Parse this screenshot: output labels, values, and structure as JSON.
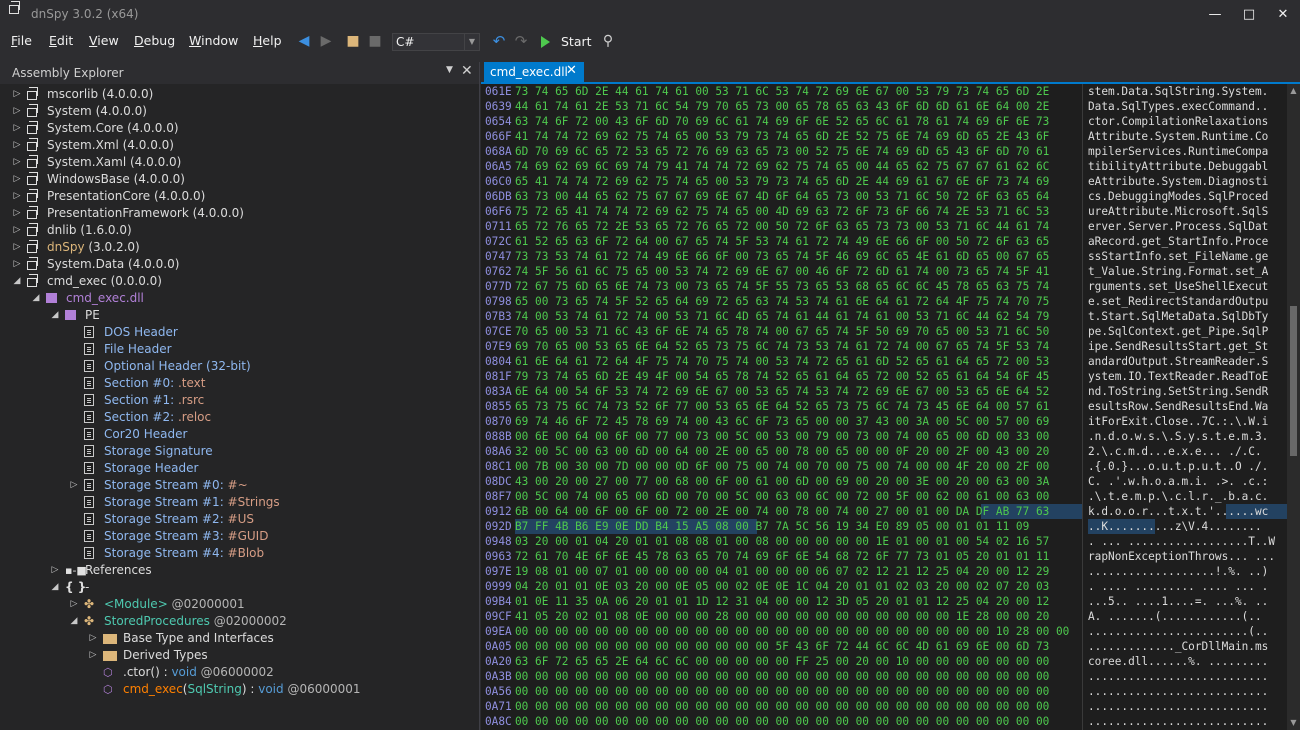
{
  "window": {
    "title": "dnSpy 3.0.2 (x64)",
    "minimize": "—",
    "maximize": "□",
    "close": "✕"
  },
  "menu": [
    "File",
    "Edit",
    "View",
    "Debug",
    "Window",
    "Help"
  ],
  "toolbar": {
    "language": "C#",
    "start_label": "Start"
  },
  "panel": {
    "title": "Assembly Explorer",
    "dropdown": "▼",
    "close": "✕"
  },
  "tree": [
    {
      "d": 0,
      "exp": "▷",
      "icon": "asm",
      "parts": [
        [
          "mscorlib",
          "w"
        ],
        [
          " (4.0.0.0)",
          "v"
        ]
      ]
    },
    {
      "d": 0,
      "exp": "▷",
      "icon": "asm",
      "parts": [
        [
          "System",
          "w"
        ],
        [
          " (4.0.0.0)",
          "v"
        ]
      ]
    },
    {
      "d": 0,
      "exp": "▷",
      "icon": "asm",
      "parts": [
        [
          "System.Core",
          "w"
        ],
        [
          " (4.0.0.0)",
          "v"
        ]
      ]
    },
    {
      "d": 0,
      "exp": "▷",
      "icon": "asm",
      "parts": [
        [
          "System.Xml",
          "w"
        ],
        [
          " (4.0.0.0)",
          "v"
        ]
      ]
    },
    {
      "d": 0,
      "exp": "▷",
      "icon": "asm",
      "parts": [
        [
          "System.Xaml",
          "w"
        ],
        [
          " (4.0.0.0)",
          "v"
        ]
      ]
    },
    {
      "d": 0,
      "exp": "▷",
      "icon": "asm",
      "parts": [
        [
          "WindowsBase",
          "w"
        ],
        [
          " (4.0.0.0)",
          "v"
        ]
      ]
    },
    {
      "d": 0,
      "exp": "▷",
      "icon": "asm",
      "parts": [
        [
          "PresentationCore",
          "w"
        ],
        [
          " (4.0.0.0)",
          "v"
        ]
      ]
    },
    {
      "d": 0,
      "exp": "▷",
      "icon": "asm",
      "parts": [
        [
          "PresentationFramework",
          "w"
        ],
        [
          " (4.0.0.0)",
          "v"
        ]
      ]
    },
    {
      "d": 0,
      "exp": "▷",
      "icon": "asm",
      "parts": [
        [
          "dnlib",
          "w"
        ],
        [
          " (1.6.0.0)",
          "v"
        ]
      ]
    },
    {
      "d": 0,
      "exp": "▷",
      "icon": "asm",
      "parts": [
        [
          "dnSpy",
          "y"
        ],
        [
          " (3.0.2.0)",
          "v"
        ]
      ]
    },
    {
      "d": 0,
      "exp": "▷",
      "icon": "asm",
      "parts": [
        [
          "System.Data",
          "w"
        ],
        [
          " (4.0.0.0)",
          "v"
        ]
      ]
    },
    {
      "d": 0,
      "exp": "◢",
      "icon": "asm",
      "parts": [
        [
          "cmd_exec",
          "w"
        ],
        [
          " (0.0.0.0)",
          "v"
        ]
      ]
    },
    {
      "d": 1,
      "exp": "◢",
      "icon": "mod",
      "parts": [
        [
          "cmd_exec.dll",
          "p"
        ]
      ]
    },
    {
      "d": 2,
      "exp": "◢",
      "icon": "mod",
      "parts": [
        [
          "PE",
          "w"
        ]
      ]
    },
    {
      "d": 3,
      "exp": "",
      "icon": "doc",
      "parts": [
        [
          "DOS Header",
          "lb"
        ]
      ]
    },
    {
      "d": 3,
      "exp": "",
      "icon": "doc",
      "parts": [
        [
          "File Header",
          "lb"
        ]
      ]
    },
    {
      "d": 3,
      "exp": "",
      "icon": "doc",
      "parts": [
        [
          "Optional Header (32-bit)",
          "lb"
        ]
      ]
    },
    {
      "d": 3,
      "exp": "",
      "icon": "doc",
      "parts": [
        [
          "Section #0: ",
          "lb"
        ],
        [
          ".text",
          "o"
        ]
      ]
    },
    {
      "d": 3,
      "exp": "",
      "icon": "doc",
      "parts": [
        [
          "Section #1: ",
          "lb"
        ],
        [
          ".rsrc",
          "o"
        ]
      ]
    },
    {
      "d": 3,
      "exp": "",
      "icon": "doc",
      "parts": [
        [
          "Section #2: ",
          "lb"
        ],
        [
          ".reloc",
          "o"
        ]
      ]
    },
    {
      "d": 3,
      "exp": "",
      "icon": "doc",
      "parts": [
        [
          "Cor20 Header",
          "lb"
        ]
      ]
    },
    {
      "d": 3,
      "exp": "",
      "icon": "doc",
      "parts": [
        [
          "Storage Signature",
          "lb"
        ]
      ]
    },
    {
      "d": 3,
      "exp": "",
      "icon": "doc",
      "parts": [
        [
          "Storage Header",
          "lb"
        ]
      ]
    },
    {
      "d": 3,
      "exp": "▷",
      "icon": "doc",
      "parts": [
        [
          "Storage Stream #0: ",
          "lb"
        ],
        [
          "#~",
          "o"
        ]
      ]
    },
    {
      "d": 3,
      "exp": "",
      "icon": "doc",
      "parts": [
        [
          "Storage Stream #1: ",
          "lb"
        ],
        [
          "#Strings",
          "o"
        ]
      ]
    },
    {
      "d": 3,
      "exp": "",
      "icon": "doc",
      "parts": [
        [
          "Storage Stream #2: ",
          "lb"
        ],
        [
          "#US",
          "o"
        ]
      ]
    },
    {
      "d": 3,
      "exp": "",
      "icon": "doc",
      "parts": [
        [
          "Storage Stream #3: ",
          "lb"
        ],
        [
          "#GUID",
          "o"
        ]
      ]
    },
    {
      "d": 3,
      "exp": "",
      "icon": "doc",
      "parts": [
        [
          "Storage Stream #4: ",
          "lb"
        ],
        [
          "#Blob",
          "o"
        ]
      ]
    },
    {
      "d": 2,
      "exp": "▷",
      "icon": "ref",
      "parts": [
        [
          "References",
          "w"
        ]
      ]
    },
    {
      "d": 2,
      "exp": "◢",
      "icon": "ns",
      "parts": [
        [
          "-",
          "w"
        ]
      ]
    },
    {
      "d": 3,
      "exp": "▷",
      "icon": "class",
      "parts": [
        [
          "<Module>",
          "t"
        ],
        [
          " @02000001",
          "k"
        ]
      ]
    },
    {
      "d": 3,
      "exp": "◢",
      "icon": "class",
      "parts": [
        [
          "StoredProcedures",
          "t"
        ],
        [
          " @02000002",
          "k"
        ]
      ]
    },
    {
      "d": 4,
      "exp": "▷",
      "icon": "folder",
      "parts": [
        [
          "Base Type and Interfaces",
          "w"
        ]
      ]
    },
    {
      "d": 4,
      "exp": "▷",
      "icon": "folder",
      "parts": [
        [
          "Derived Types",
          "w"
        ]
      ]
    },
    {
      "d": 4,
      "exp": "",
      "icon": "method",
      "parts": [
        [
          ".ctor",
          "w"
        ],
        [
          "() : ",
          "w"
        ],
        [
          "void",
          "kw"
        ],
        [
          " @06000002",
          "k"
        ]
      ]
    },
    {
      "d": 4,
      "exp": "",
      "icon": "method",
      "parts": [
        [
          "cmd_exec",
          "m"
        ],
        [
          "(",
          "w"
        ],
        [
          "SqlString",
          "t2"
        ],
        [
          ") : ",
          "w"
        ],
        [
          "void",
          "kw"
        ],
        [
          " @06000001",
          "k"
        ]
      ]
    }
  ],
  "tab": {
    "label": "cmd_exec.dll",
    "close": "✕"
  },
  "hex": [
    {
      "off": "061E",
      "b": "73 74 65 6D 2E 44 61 74 61 00 53 71 6C 53 74 72 69 6E 67 00 53 79 73 74 65 6D 2E",
      "a": "stem.Data.SqlString.System."
    },
    {
      "off": "0639",
      "b": "44 61 74 61 2E 53 71 6C 54 79 70 65 73 00 65 78 65 63 43 6F 6D 6D 61 6E 64 00 2E",
      "a": "Data.SqlTypes.execCommand.."
    },
    {
      "off": "0654",
      "b": "63 74 6F 72 00 43 6F 6D 70 69 6C 61 74 69 6F 6E 52 65 6C 61 78 61 74 69 6F 6E 73",
      "a": "ctor.CompilationRelaxations"
    },
    {
      "off": "066F",
      "b": "41 74 74 72 69 62 75 74 65 00 53 79 73 74 65 6D 2E 52 75 6E 74 69 6D 65 2E 43 6F",
      "a": "Attribute.System.Runtime.Co"
    },
    {
      "off": "068A",
      "b": "6D 70 69 6C 65 72 53 65 72 76 69 63 65 73 00 52 75 6E 74 69 6D 65 43 6F 6D 70 61",
      "a": "mpilerServices.RuntimeCompa"
    },
    {
      "off": "06A5",
      "b": "74 69 62 69 6C 69 74 79 41 74 74 72 69 62 75 74 65 00 44 65 62 75 67 67 61 62 6C",
      "a": "tibilityAttribute.Debuggabl"
    },
    {
      "off": "06C0",
      "b": "65 41 74 74 72 69 62 75 74 65 00 53 79 73 74 65 6D 2E 44 69 61 67 6E 6F 73 74 69",
      "a": "eAttribute.System.Diagnosti"
    },
    {
      "off": "06DB",
      "b": "63 73 00 44 65 62 75 67 67 69 6E 67 4D 6F 64 65 73 00 53 71 6C 50 72 6F 63 65 64",
      "a": "cs.DebuggingModes.SqlProced"
    },
    {
      "off": "06F6",
      "b": "75 72 65 41 74 74 72 69 62 75 74 65 00 4D 69 63 72 6F 73 6F 66 74 2E 53 71 6C 53",
      "a": "ureAttribute.Microsoft.SqlS"
    },
    {
      "off": "0711",
      "b": "65 72 76 65 72 2E 53 65 72 76 65 72 00 50 72 6F 63 65 73 73 00 53 71 6C 44 61 74",
      "a": "erver.Server.Process.SqlDat"
    },
    {
      "off": "072C",
      "b": "61 52 65 63 6F 72 64 00 67 65 74 5F 53 74 61 72 74 49 6E 66 6F 00 50 72 6F 63 65",
      "a": "aRecord.get_StartInfo.Proce"
    },
    {
      "off": "0747",
      "b": "73 73 53 74 61 72 74 49 6E 66 6F 00 73 65 74 5F 46 69 6C 65 4E 61 6D 65 00 67 65",
      "a": "ssStartInfo.set_FileName.ge"
    },
    {
      "off": "0762",
      "b": "74 5F 56 61 6C 75 65 00 53 74 72 69 6E 67 00 46 6F 72 6D 61 74 00 73 65 74 5F 41",
      "a": "t_Value.String.Format.set_A"
    },
    {
      "off": "077D",
      "b": "72 67 75 6D 65 6E 74 73 00 73 65 74 5F 55 73 65 53 68 65 6C 6C 45 78 65 63 75 74",
      "a": "rguments.set_UseShellExecut"
    },
    {
      "off": "0798",
      "b": "65 00 73 65 74 5F 52 65 64 69 72 65 63 74 53 74 61 6E 64 61 72 64 4F 75 74 70 75",
      "a": "e.set_RedirectStandardOutpu"
    },
    {
      "off": "07B3",
      "b": "74 00 53 74 61 72 74 00 53 71 6C 4D 65 74 61 44 61 74 61 00 53 71 6C 44 62 54 79",
      "a": "t.Start.SqlMetaData.SqlDbTy"
    },
    {
      "off": "07CE",
      "b": "70 65 00 53 71 6C 43 6F 6E 74 65 78 74 00 67 65 74 5F 50 69 70 65 00 53 71 6C 50",
      "a": "pe.SqlContext.get_Pipe.SqlP"
    },
    {
      "off": "07E9",
      "b": "69 70 65 00 53 65 6E 64 52 65 73 75 6C 74 73 53 74 61 72 74 00 67 65 74 5F 53 74",
      "a": "ipe.SendResultsStart.get_St"
    },
    {
      "off": "0804",
      "b": "61 6E 64 61 72 64 4F 75 74 70 75 74 00 53 74 72 65 61 6D 52 65 61 64 65 72 00 53",
      "a": "andardOutput.StreamReader.S"
    },
    {
      "off": "081F",
      "b": "79 73 74 65 6D 2E 49 4F 00 54 65 78 74 52 65 61 64 65 72 00 52 65 61 64 54 6F 45",
      "a": "ystem.IO.TextReader.ReadToE"
    },
    {
      "off": "083A",
      "b": "6E 64 00 54 6F 53 74 72 69 6E 67 00 53 65 74 53 74 72 69 6E 67 00 53 65 6E 64 52",
      "a": "nd.ToString.SetString.SendR"
    },
    {
      "off": "0855",
      "b": "65 73 75 6C 74 73 52 6F 77 00 53 65 6E 64 52 65 73 75 6C 74 73 45 6E 64 00 57 61",
      "a": "esultsRow.SendResultsEnd.Wa"
    },
    {
      "off": "0870",
      "b": "69 74 46 6F 72 45 78 69 74 00 43 6C 6F 73 65 00 00 37 43 00 3A 00 5C 00 57 00 69",
      "a": "itForExit.Close..7C.:.\\.W.i"
    },
    {
      "off": "088B",
      "b": "00 6E 00 64 00 6F 00 77 00 73 00 5C 00 53 00 79 00 73 00 74 00 65 00 6D 00 33 00",
      "a": ".n.d.o.w.s.\\.S.y.s.t.e.m.3."
    },
    {
      "off": "08A6",
      "b": "32 00 5C 00 63 00 6D 00 64 00 2E 00 65 00 78 00 65 00 00 0F 20 00 2F 00 43 00 20",
      "a": "2.\\.c.m.d...e.x.e... ./.C. "
    },
    {
      "off": "08C1",
      "b": "00 7B 00 30 00 7D 00 00 0D 6F 00 75 00 74 00 70 00 75 00 74 00 00 4F 20 00 2F 00",
      "a": ".{.0.}...o.u.t.p.u.t..O ./."
    },
    {
      "off": "08DC",
      "b": "43 00 20 00 27 00 77 00 68 00 6F 00 61 00 6D 00 69 00 20 00 3E 00 20 00 63 00 3A",
      "a": "C. .'.w.h.o.a.m.i. .>. .c.:"
    },
    {
      "off": "08F7",
      "b": "00 5C 00 74 00 65 00 6D 00 70 00 5C 00 63 00 6C 00 72 00 5F 00 62 00 61 00 63 00",
      "a": ".\\.t.e.m.p.\\.c.l.r._.b.a.c."
    },
    {
      "off": "0912",
      "b": "6B 00 64 00 6F 00 6F 00 72 00 2E 00 74 00 78 00 74 00 27 00 01 00 DA DF AB 77 63",
      "a": "k.d.o.o.r...t.x.t.'......wc"
    },
    {
      "off": "092D",
      "b": "B7 FF 4B B6 E9 0E DD B4 15 A5 08 00 B7 7A 5C 56 19 34 E0 89 05 00 01 01 11 09",
      "a": "..K..........z\\V.4........"
    },
    {
      "off": "0948",
      "b": "03 20 00 01 04 20 01 01 08 08 01 00 08 00 00 00 00 00 1E 01 00 01 00 54 02 16 57",
      "a": ". ... ..................T..W"
    },
    {
      "off": "0963",
      "b": "72 61 70 4E 6F 6E 45 78 63 65 70 74 69 6F 6E 54 68 72 6F 77 73 01 05 20 01 01 11",
      "a": "rapNonExceptionThrows... ..."
    },
    {
      "off": "097E",
      "b": "19 08 01 00 07 01 00 00 00 00 04 01 00 00 00 06 07 02 12 21 12 25 04 20 00 12 29",
      "a": "...................!.%. ..)"
    },
    {
      "off": "0999",
      "b": "04 20 01 01 0E 03 20 00 0E 05 00 02 0E 0E 1C 04 20 01 01 02 03 20 00 02 07 20 03",
      "a": ". .... ......... .... ... ."
    },
    {
      "off": "09B4",
      "b": "01 0E 11 35 0A 06 20 01 01 1D 12 31 04 00 00 12 3D 05 20 01 01 12 25 04 20 00 12",
      "a": "...5.. ....1....=. ...%. .."
    },
    {
      "off": "09CF",
      "b": "41 05 20 02 01 08 0E 00 00 00 28 00 00 00 00 00 00 00 00 00 00 00 1E 28 00 00 20",
      "a": "A. .......(............(.. "
    },
    {
      "off": "09EA",
      "b": "00 00 00 00 00 00 00 00 00 00 00 00 00 00 00 00 00 00 00 00 00 00 00 00 10 28 00 00",
      "a": "........................(.."
    },
    {
      "off": "0A05",
      "b": "00 00 00 00 00 00 00 00 00 00 00 00 00 5F 43 6F 72 44 6C 6C 4D 61 69 6E 00 6D 73",
      "a": "............._CorDllMain.ms"
    },
    {
      "off": "0A20",
      "b": "63 6F 72 65 65 2E 64 6C 6C 00 00 00 00 00 FF 25 00 20 00 10 00 00 00 00 00 00 00",
      "a": "coree.dll......%. ........."
    },
    {
      "off": "0A3B",
      "b": "00 00 00 00 00 00 00 00 00 00 00 00 00 00 00 00 00 00 00 00 00 00 00 00 00 00 00",
      "a": "..........................."
    },
    {
      "off": "0A56",
      "b": "00 00 00 00 00 00 00 00 00 00 00 00 00 00 00 00 00 00 00 00 00 00 00 00 00 00 00",
      "a": "..........................."
    },
    {
      "off": "0A71",
      "b": "00 00 00 00 00 00 00 00 00 00 00 00 00 00 00 00 00 00 00 00 00 00 00 00 00 00 00",
      "a": "..........................."
    },
    {
      "off": "0A8C",
      "b": "00 00 00 00 00 00 00 00 00 00 00 00 00 00 00 00 00 00 00 00 00 00 00 00 00 00 00",
      "a": "..........................."
    }
  ]
}
